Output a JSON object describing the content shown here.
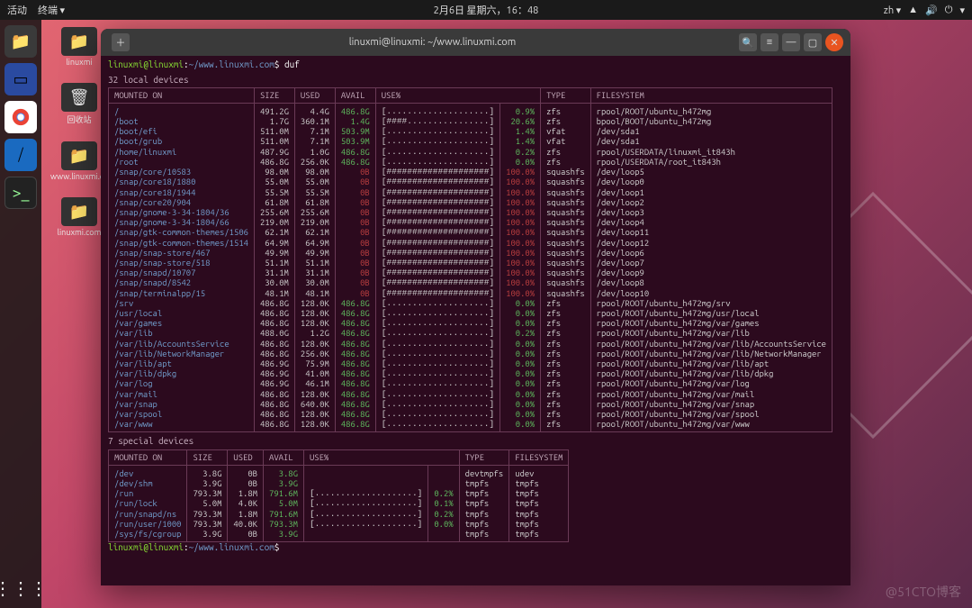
{
  "topbar": {
    "activities": "活动",
    "terminal": "终端 ▾",
    "datetime": "2月6日 星期六，16：48",
    "lang": "zh ▾"
  },
  "desktop": {
    "folder1": "linuxmi",
    "trash": "回收站",
    "folder2": "www.linuxmi.com",
    "folder3": "linuxmi.com"
  },
  "terminal": {
    "title": "linuxmi@linuxmi: ~/www.linuxmi.com",
    "prompt_user": "linuxmi@linuxmi",
    "prompt_sep": ":",
    "prompt_path": "~/www.linuxmi.com",
    "prompt_dollar": "$",
    "cmd": "duf",
    "local_title": "32 local devices",
    "special_title": "7 special devices",
    "headers": {
      "mount": "MOUNTED ON",
      "size": "SIZE",
      "used": "USED",
      "avail": "AVAIL",
      "usepct": "USE%",
      "type": "TYPE",
      "fs": "FILESYSTEM"
    },
    "local": [
      {
        "m": "/",
        "s": "491.2G",
        "u": "4.4G",
        "a": "486.8G",
        "bar": "[....................]",
        "p": "0.9%",
        "t": "zfs",
        "f": "rpool/ROOT/ubuntu_h472mg"
      },
      {
        "m": "/boot",
        "s": "1.7G",
        "u": "360.1M",
        "a": "1.4G",
        "bar": "[####................]",
        "p": "20.6%",
        "t": "zfs",
        "f": "bpool/BOOT/ubuntu_h472mg"
      },
      {
        "m": "/boot/efi",
        "s": "511.0M",
        "u": "7.1M",
        "a": "503.9M",
        "bar": "[....................]",
        "p": "1.4%",
        "t": "vfat",
        "f": "/dev/sda1"
      },
      {
        "m": "/boot/grub",
        "s": "511.0M",
        "u": "7.1M",
        "a": "503.9M",
        "bar": "[....................]",
        "p": "1.4%",
        "t": "vfat",
        "f": "/dev/sda1"
      },
      {
        "m": "/home/linuxmi",
        "s": "487.9G",
        "u": "1.0G",
        "a": "486.8G",
        "bar": "[....................]",
        "p": "0.2%",
        "t": "zfs",
        "f": "rpool/USERDATA/linuxmi_it843h"
      },
      {
        "m": "/root",
        "s": "486.8G",
        "u": "256.0K",
        "a": "486.8G",
        "bar": "[....................]",
        "p": "0.0%",
        "t": "zfs",
        "f": "rpool/USERDATA/root_it843h"
      },
      {
        "m": "/snap/core/10583",
        "s": "98.0M",
        "u": "98.0M",
        "a": "0B",
        "bar": "[####################]",
        "p": "100.0%",
        "t": "squashfs",
        "f": "/dev/loop5"
      },
      {
        "m": "/snap/core18/1880",
        "s": "55.0M",
        "u": "55.0M",
        "a": "0B",
        "bar": "[####################]",
        "p": "100.0%",
        "t": "squashfs",
        "f": "/dev/loop0"
      },
      {
        "m": "/snap/core18/1944",
        "s": "55.5M",
        "u": "55.5M",
        "a": "0B",
        "bar": "[####################]",
        "p": "100.0%",
        "t": "squashfs",
        "f": "/dev/loop1"
      },
      {
        "m": "/snap/core20/904",
        "s": "61.8M",
        "u": "61.8M",
        "a": "0B",
        "bar": "[####################]",
        "p": "100.0%",
        "t": "squashfs",
        "f": "/dev/loop2"
      },
      {
        "m": "/snap/gnome-3-34-1804/36",
        "s": "255.6M",
        "u": "255.6M",
        "a": "0B",
        "bar": "[####################]",
        "p": "100.0%",
        "t": "squashfs",
        "f": "/dev/loop3"
      },
      {
        "m": "/snap/gnome-3-34-1804/66",
        "s": "219.0M",
        "u": "219.0M",
        "a": "0B",
        "bar": "[####################]",
        "p": "100.0%",
        "t": "squashfs",
        "f": "/dev/loop4"
      },
      {
        "m": "/snap/gtk-common-themes/1506",
        "s": "62.1M",
        "u": "62.1M",
        "a": "0B",
        "bar": "[####################]",
        "p": "100.0%",
        "t": "squashfs",
        "f": "/dev/loop11"
      },
      {
        "m": "/snap/gtk-common-themes/1514",
        "s": "64.9M",
        "u": "64.9M",
        "a": "0B",
        "bar": "[####################]",
        "p": "100.0%",
        "t": "squashfs",
        "f": "/dev/loop12"
      },
      {
        "m": "/snap/snap-store/467",
        "s": "49.9M",
        "u": "49.9M",
        "a": "0B",
        "bar": "[####################]",
        "p": "100.0%",
        "t": "squashfs",
        "f": "/dev/loop6"
      },
      {
        "m": "/snap/snap-store/518",
        "s": "51.1M",
        "u": "51.1M",
        "a": "0B",
        "bar": "[####################]",
        "p": "100.0%",
        "t": "squashfs",
        "f": "/dev/loop7"
      },
      {
        "m": "/snap/snapd/10707",
        "s": "31.1M",
        "u": "31.1M",
        "a": "0B",
        "bar": "[####################]",
        "p": "100.0%",
        "t": "squashfs",
        "f": "/dev/loop9"
      },
      {
        "m": "/snap/snapd/8542",
        "s": "30.0M",
        "u": "30.0M",
        "a": "0B",
        "bar": "[####################]",
        "p": "100.0%",
        "t": "squashfs",
        "f": "/dev/loop8"
      },
      {
        "m": "/snap/terminalpp/15",
        "s": "48.1M",
        "u": "48.1M",
        "a": "0B",
        "bar": "[####################]",
        "p": "100.0%",
        "t": "squashfs",
        "f": "/dev/loop10"
      },
      {
        "m": "/srv",
        "s": "486.8G",
        "u": "128.0K",
        "a": "486.8G",
        "bar": "[....................]",
        "p": "0.0%",
        "t": "zfs",
        "f": "rpool/ROOT/ubuntu_h472mg/srv"
      },
      {
        "m": "/usr/local",
        "s": "486.8G",
        "u": "128.0K",
        "a": "486.8G",
        "bar": "[....................]",
        "p": "0.0%",
        "t": "zfs",
        "f": "rpool/ROOT/ubuntu_h472mg/usr/local"
      },
      {
        "m": "/var/games",
        "s": "486.8G",
        "u": "128.0K",
        "a": "486.8G",
        "bar": "[....................]",
        "p": "0.0%",
        "t": "zfs",
        "f": "rpool/ROOT/ubuntu_h472mg/var/games"
      },
      {
        "m": "/var/lib",
        "s": "488.0G",
        "u": "1.2G",
        "a": "486.8G",
        "bar": "[....................]",
        "p": "0.2%",
        "t": "zfs",
        "f": "rpool/ROOT/ubuntu_h472mg/var/lib"
      },
      {
        "m": "/var/lib/AccountsService",
        "s": "486.8G",
        "u": "128.0K",
        "a": "486.8G",
        "bar": "[....................]",
        "p": "0.0%",
        "t": "zfs",
        "f": "rpool/ROOT/ubuntu_h472mg/var/lib/AccountsService"
      },
      {
        "m": "/var/lib/NetworkManager",
        "s": "486.8G",
        "u": "256.0K",
        "a": "486.8G",
        "bar": "[....................]",
        "p": "0.0%",
        "t": "zfs",
        "f": "rpool/ROOT/ubuntu_h472mg/var/lib/NetworkManager"
      },
      {
        "m": "/var/lib/apt",
        "s": "486.9G",
        "u": "75.9M",
        "a": "486.8G",
        "bar": "[....................]",
        "p": "0.0%",
        "t": "zfs",
        "f": "rpool/ROOT/ubuntu_h472mg/var/lib/apt"
      },
      {
        "m": "/var/lib/dpkg",
        "s": "486.9G",
        "u": "41.0M",
        "a": "486.8G",
        "bar": "[....................]",
        "p": "0.0%",
        "t": "zfs",
        "f": "rpool/ROOT/ubuntu_h472mg/var/lib/dpkg"
      },
      {
        "m": "/var/log",
        "s": "486.9G",
        "u": "46.1M",
        "a": "486.8G",
        "bar": "[....................]",
        "p": "0.0%",
        "t": "zfs",
        "f": "rpool/ROOT/ubuntu_h472mg/var/log"
      },
      {
        "m": "/var/mail",
        "s": "486.8G",
        "u": "128.0K",
        "a": "486.8G",
        "bar": "[....................]",
        "p": "0.0%",
        "t": "zfs",
        "f": "rpool/ROOT/ubuntu_h472mg/var/mail"
      },
      {
        "m": "/var/snap",
        "s": "486.8G",
        "u": "640.0K",
        "a": "486.8G",
        "bar": "[....................]",
        "p": "0.0%",
        "t": "zfs",
        "f": "rpool/ROOT/ubuntu_h472mg/var/snap"
      },
      {
        "m": "/var/spool",
        "s": "486.8G",
        "u": "128.0K",
        "a": "486.8G",
        "bar": "[....................]",
        "p": "0.0%",
        "t": "zfs",
        "f": "rpool/ROOT/ubuntu_h472mg/var/spool"
      },
      {
        "m": "/var/www",
        "s": "486.8G",
        "u": "128.0K",
        "a": "486.8G",
        "bar": "[....................]",
        "p": "0.0%",
        "t": "zfs",
        "f": "rpool/ROOT/ubuntu_h472mg/var/www"
      }
    ],
    "special": [
      {
        "m": "/dev",
        "s": "3.8G",
        "u": "0B",
        "a": "3.8G",
        "bar": "",
        "p": "",
        "t": "devtmpfs",
        "f": "udev"
      },
      {
        "m": "/dev/shm",
        "s": "3.9G",
        "u": "0B",
        "a": "3.9G",
        "bar": "",
        "p": "",
        "t": "tmpfs",
        "f": "tmpfs"
      },
      {
        "m": "/run",
        "s": "793.3M",
        "u": "1.8M",
        "a": "791.6M",
        "bar": "[....................]",
        "p": "0.2%",
        "t": "tmpfs",
        "f": "tmpfs"
      },
      {
        "m": "/run/lock",
        "s": "5.0M",
        "u": "4.0K",
        "a": "5.0M",
        "bar": "[....................]",
        "p": "0.1%",
        "t": "tmpfs",
        "f": "tmpfs"
      },
      {
        "m": "/run/snapd/ns",
        "s": "793.3M",
        "u": "1.8M",
        "a": "791.6M",
        "bar": "[....................]",
        "p": "0.2%",
        "t": "tmpfs",
        "f": "tmpfs"
      },
      {
        "m": "/run/user/1000",
        "s": "793.3M",
        "u": "40.0K",
        "a": "793.3M",
        "bar": "[....................]",
        "p": "0.0%",
        "t": "tmpfs",
        "f": "tmpfs"
      },
      {
        "m": "/sys/fs/cgroup",
        "s": "3.9G",
        "u": "0B",
        "a": "3.9G",
        "bar": "",
        "p": "",
        "t": "tmpfs",
        "f": "tmpfs"
      }
    ]
  },
  "watermark": "@51CTO博客"
}
